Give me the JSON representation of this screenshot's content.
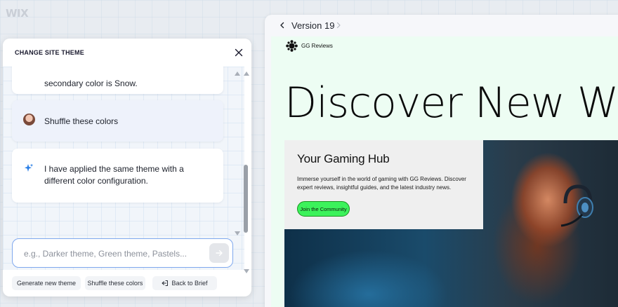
{
  "app": {
    "logo_text": "WIX"
  },
  "panel": {
    "title": "CHANGE SITE THEME",
    "messages": [
      {
        "role": "user",
        "text": "secondary color is Snow."
      },
      {
        "role": "user",
        "text": "Shuffle these colors"
      },
      {
        "role": "assistant",
        "text": "I have applied the same theme with a different color configuration."
      }
    ],
    "input": {
      "placeholder": "e.g., Darker theme, Green theme, Pastels...",
      "value": ""
    },
    "chips": [
      "Generate new theme",
      "Shuffle these colors",
      "Back to Brief"
    ],
    "scrollbar": {
      "thumb_fraction": 0.36
    }
  },
  "preview": {
    "version_label": "Version 19",
    "site": {
      "brand_name": "GG Reviews",
      "hero_title": "Discover New W",
      "card_title": "Your Gaming Hub",
      "card_text": "Immerse yourself in the world of gaming with GG Reviews. Discover expert reviews, insightful guides, and the latest industry news.",
      "cta_label": "Join the Community"
    }
  },
  "colors": {
    "accent_input_border": "#7fa8ee",
    "sparkle": "#2b7fe6",
    "site_background": "#edfdf3",
    "cta_green": "#3cf25b"
  },
  "icons": [
    "close-icon",
    "sparkle-icon",
    "send-arrow-icon",
    "back-icon",
    "chevron-left-icon",
    "chevron-right-icon",
    "brand-logo-icon",
    "headset-icon"
  ]
}
